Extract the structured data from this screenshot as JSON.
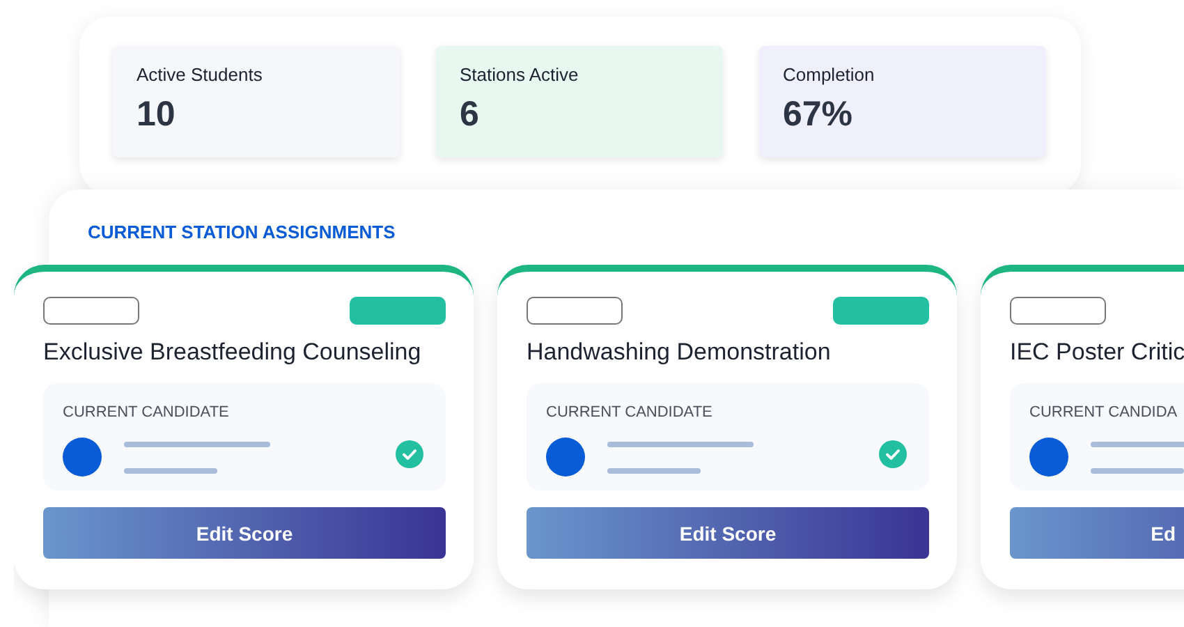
{
  "stats": [
    {
      "label": "Active Students",
      "value": "10",
      "color": "#f5f7fa"
    },
    {
      "label": "Stations Active",
      "value": "6",
      "color": "#e9f7f1"
    },
    {
      "label": "Completion",
      "value": "67%",
      "color": "#eff0fc"
    }
  ],
  "assignments": {
    "heading": "CURRENT STATION ASSIGNMENTS",
    "stations": [
      {
        "title": "Exclusive Breastfeeding Counseling",
        "candidate_label": "CURRENT CANDIDATE",
        "button": "Edit Score",
        "completed": true
      },
      {
        "title": "Handwashing Demonstration",
        "candidate_label": "CURRENT CANDIDATE",
        "button": "Edit Score",
        "completed": true
      },
      {
        "title": "IEC Poster Critic",
        "candidate_label": "CURRENT CANDIDA",
        "button": "Ed"
      }
    ]
  }
}
